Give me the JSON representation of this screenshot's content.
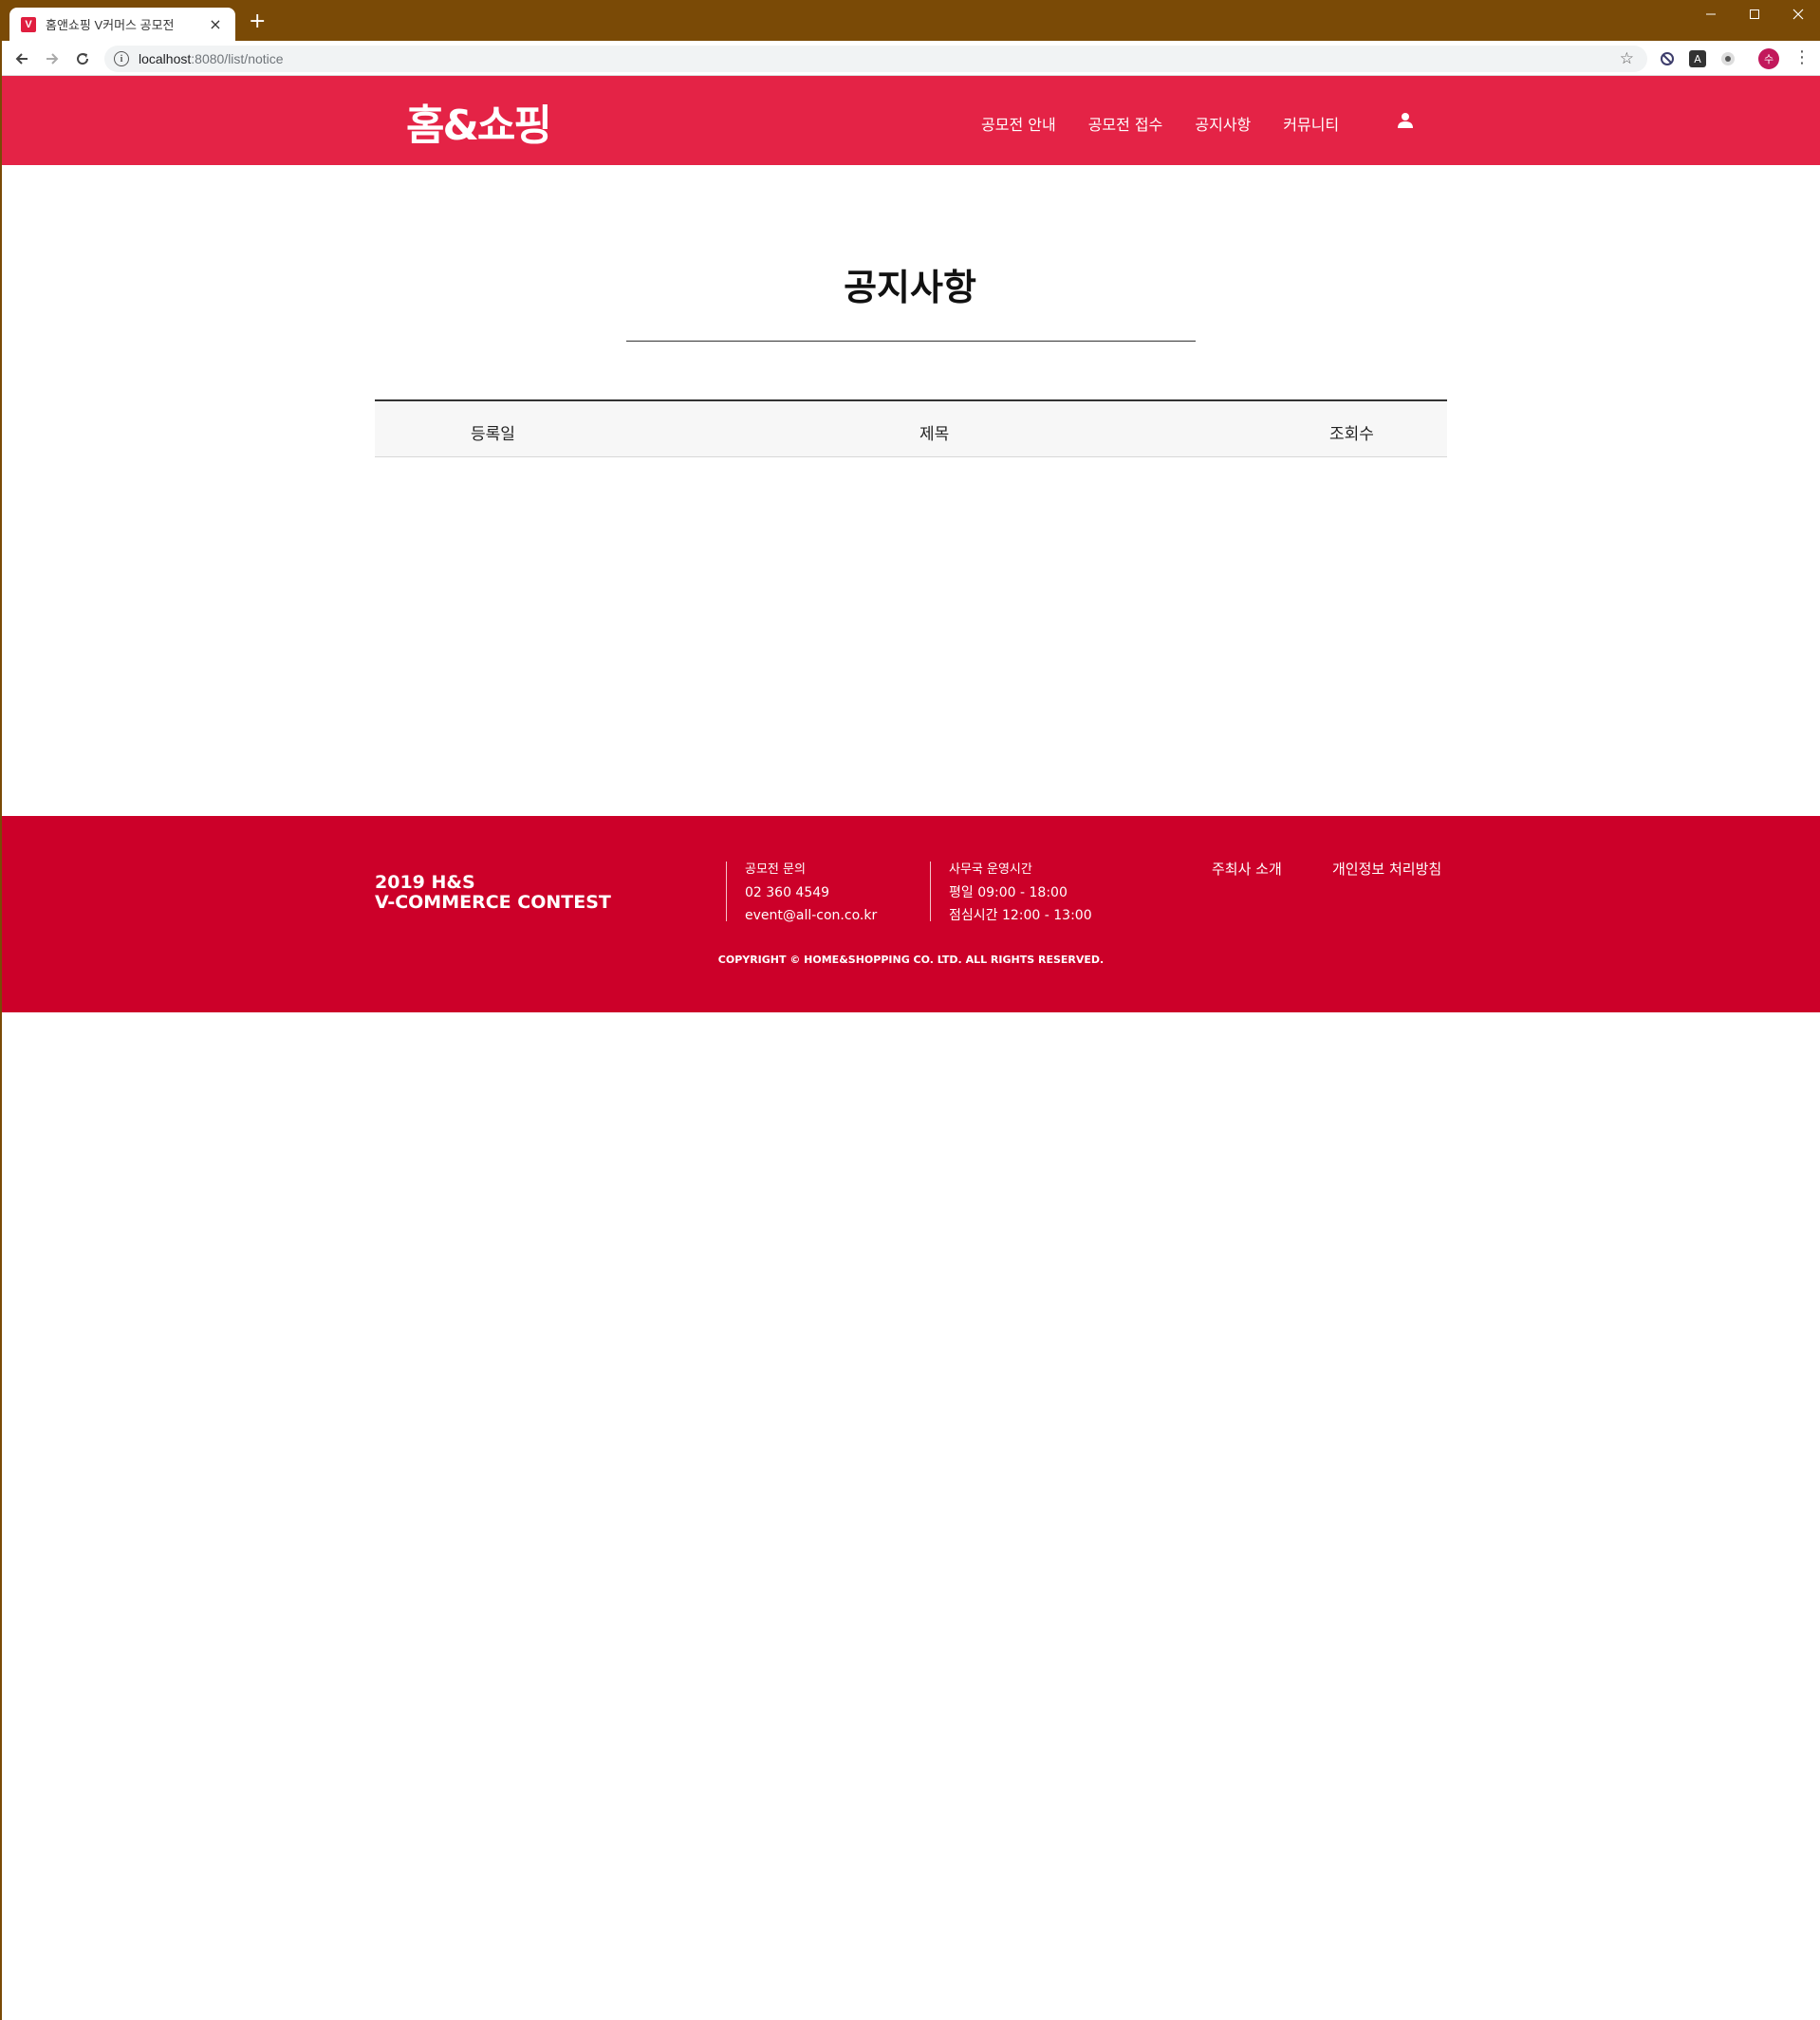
{
  "browser": {
    "tab_title": "홈앤쇼핑 V커머스 공모전",
    "tab_close": "×",
    "new_tab": "+",
    "url_host": "localhost",
    "url_path": ":8080/list/notice",
    "profile_initial": "수"
  },
  "header": {
    "logo": "홈&쇼핑",
    "nav": [
      "공모전 안내",
      "공모전 접수",
      "공지사항",
      "커뮤니티"
    ]
  },
  "main": {
    "title": "공지사항",
    "columns": [
      "등록일",
      "제목",
      "조회수"
    ],
    "rows": []
  },
  "footer": {
    "brand_line1": "2019 H&S",
    "brand_line2": "V-COMMERCE CONTEST",
    "contact_label": "공모전 문의",
    "contact_phone": "02 360 4549",
    "contact_email": "event@all-con.co.kr",
    "hours_label": "사무국 운영시간",
    "hours_weekday": "평일 09:00 - 18:00",
    "hours_lunch": "점심시간 12:00 - 13:00",
    "link_about": "주최사 소개",
    "link_privacy": "개인정보 처리방침",
    "copyright": "COPYRIGHT © HOME&SHOPPING CO. LTD. ALL RIGHTS RESERVED."
  },
  "colors": {
    "titlebar": "#7a4a06",
    "header": "#e42346",
    "footer": "#cc0029"
  }
}
